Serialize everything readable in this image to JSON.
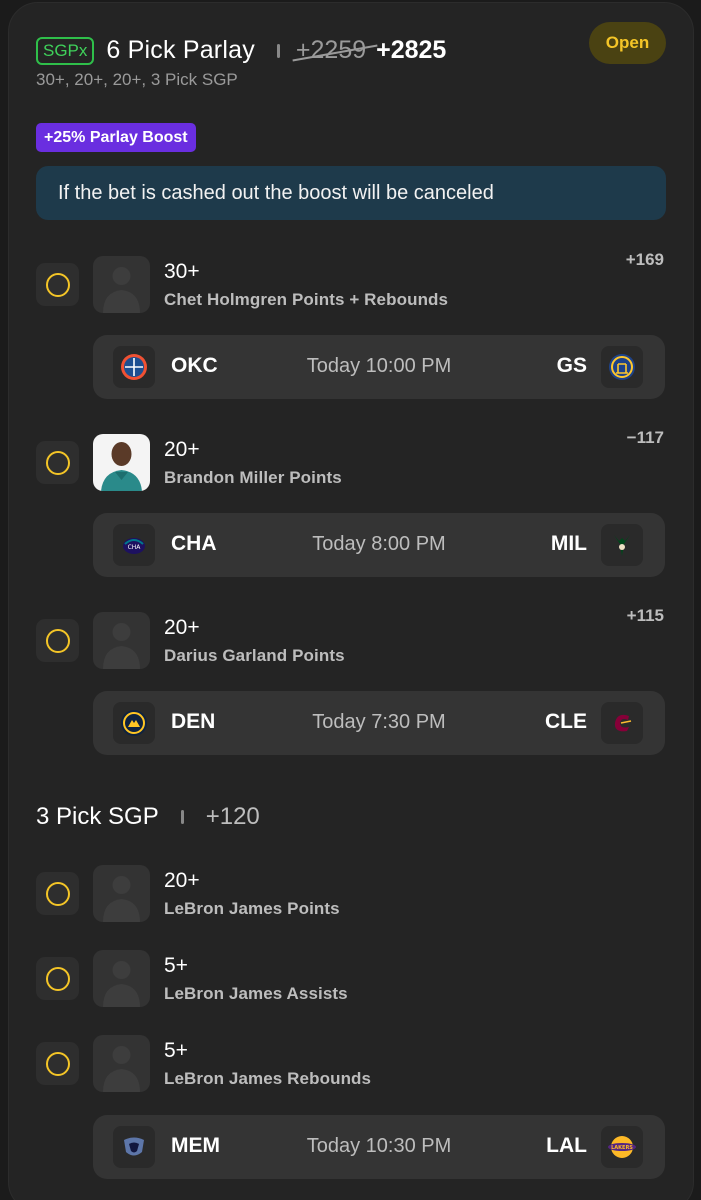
{
  "header": {
    "badge": "SGPx",
    "title": "6 Pick Parlay",
    "old_odds": "+2259",
    "new_odds": "+2825",
    "subtitle": "30+, 20+, 20+, 3 Pick SGP",
    "status": "Open"
  },
  "boost": {
    "label": "+25% Parlay Boost",
    "notice": "If the bet is cashed out the boost will be canceled"
  },
  "legs": [
    {
      "line": "30+",
      "desc": "Chet Holmgren Points + Rebounds",
      "odds": "+169",
      "game": {
        "home": "OKC",
        "away": "GS",
        "time": "Today 10:00 PM"
      }
    },
    {
      "line": "20+",
      "desc": "Brandon Miller Points",
      "odds": "−117",
      "game": {
        "home": "CHA",
        "away": "MIL",
        "time": "Today 8:00 PM"
      }
    },
    {
      "line": "20+",
      "desc": "Darius Garland Points",
      "odds": "+115",
      "game": {
        "home": "DEN",
        "away": "CLE",
        "time": "Today 7:30 PM"
      }
    }
  ],
  "sgp": {
    "title": "3 Pick SGP",
    "odds": "+120",
    "legs": [
      {
        "line": "20+",
        "desc": "LeBron James Points"
      },
      {
        "line": "5+",
        "desc": "LeBron James Assists"
      },
      {
        "line": "5+",
        "desc": "LeBron James Rebounds"
      }
    ],
    "game": {
      "home": "MEM",
      "away": "LAL",
      "time": "Today 10:30 PM"
    }
  },
  "colors": {
    "accent": "#f4c527",
    "boost": "#6a2ee0",
    "sgpx": "#3fd05a",
    "banner": "#1e3a4b"
  }
}
